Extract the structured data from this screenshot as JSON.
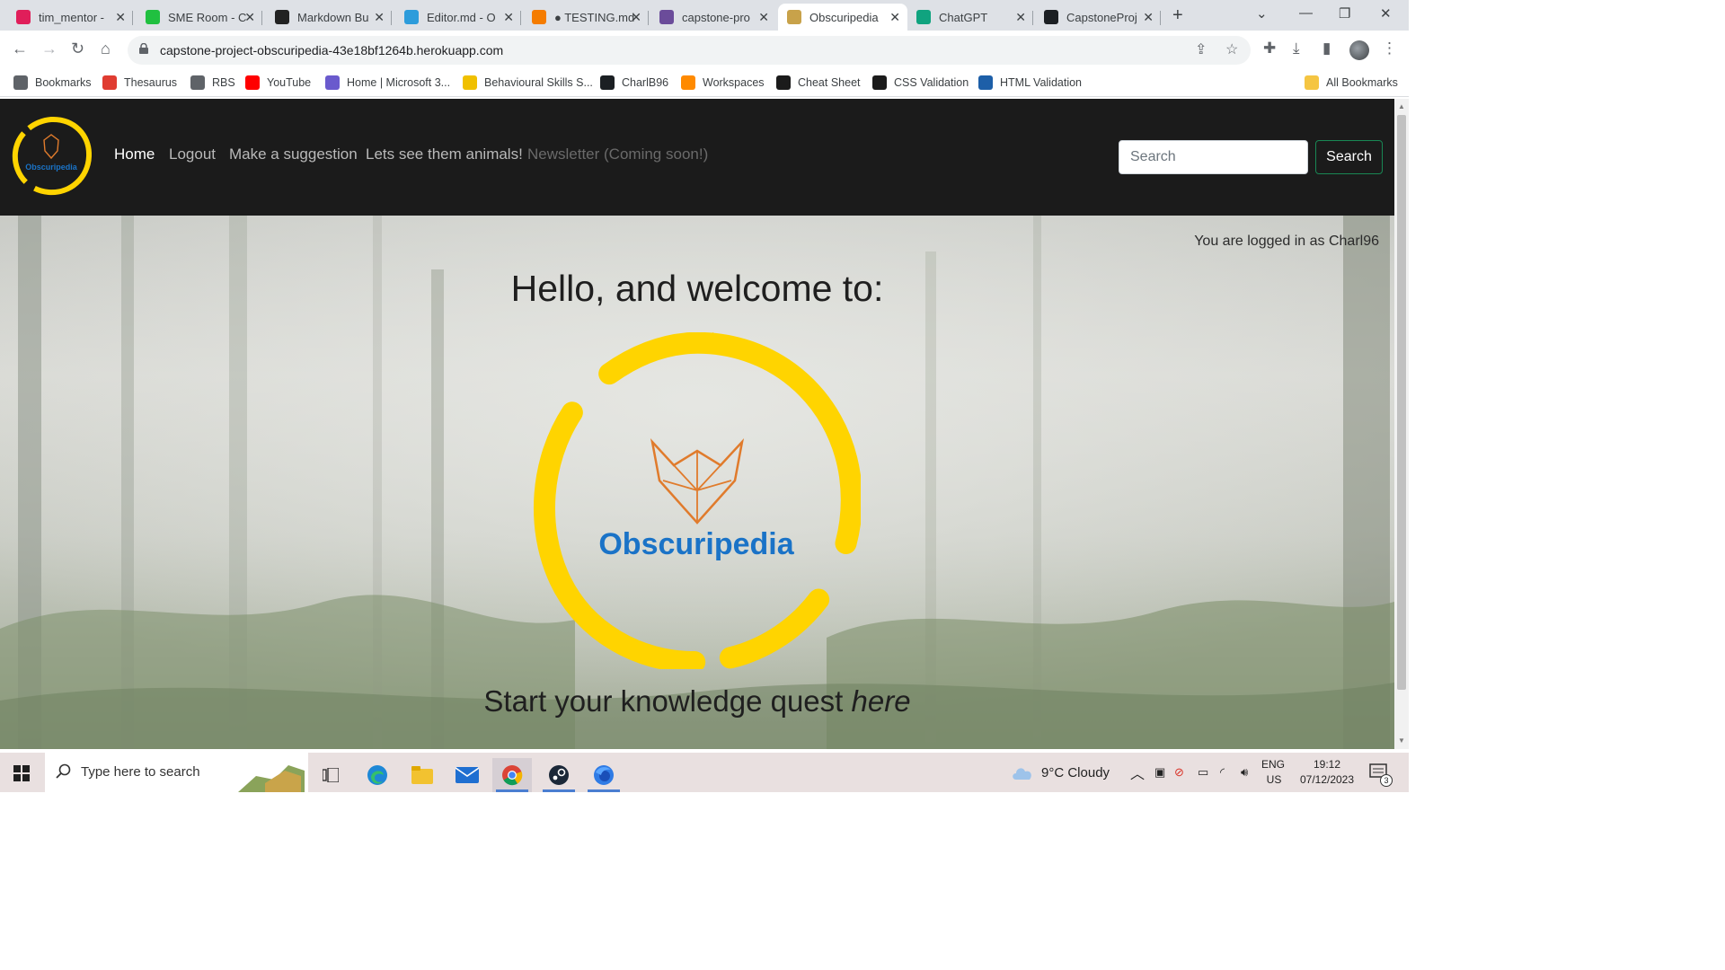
{
  "browser": {
    "tabs": [
      {
        "label": "tim_mentor -",
        "favicon_color": "#e01e5a",
        "favicon": "slack-icon"
      },
      {
        "label": "SME Room - C",
        "favicon_color": "#20c040",
        "favicon": "circle-icon"
      },
      {
        "label": "Markdown Bu",
        "favicon_color": "#222222",
        "favicon": "markdown-icon"
      },
      {
        "label": "Editor.md - O",
        "favicon_color": "#2d9cdb",
        "favicon": "m-icon"
      },
      {
        "label": "● TESTING.md",
        "favicon_color": "#f57c00",
        "favicon": "g-icon"
      },
      {
        "label": "capstone-pro",
        "favicon_color": "#6b4c9a",
        "favicon": "heroku-icon"
      },
      {
        "label": "Obscuripedia",
        "favicon_color": "#c8a24a",
        "favicon": "fox-icon"
      },
      {
        "label": "ChatGPT",
        "favicon_color": "#10a37f",
        "favicon": "chatgpt-icon"
      },
      {
        "label": "CapstoneProj",
        "favicon_color": "#1b1f23",
        "favicon": "github-icon"
      }
    ],
    "url": "capstone-project-obscuripedia-43e18bf1264b.herokuapp.com",
    "bookmarks": [
      {
        "label": "Bookmarks",
        "icon": "star-icon",
        "color": "#5f6368"
      },
      {
        "label": "Thesaurus",
        "icon": "thesaurus-icon",
        "color": "#e03c31"
      },
      {
        "label": "RBS",
        "icon": "globe-icon",
        "color": "#5f6368"
      },
      {
        "label": "YouTube",
        "icon": "youtube-icon",
        "color": "#ff0000"
      },
      {
        "label": "Home | Microsoft 3...",
        "icon": "microsoft-icon",
        "color": "#6a5acd"
      },
      {
        "label": "Behavioural Skills S...",
        "icon": "w-icon",
        "color": "#f0c000"
      },
      {
        "label": "CharlB96",
        "icon": "github-icon",
        "color": "#1b1f23"
      },
      {
        "label": "Workspaces",
        "icon": "gitpod-icon",
        "color": "#ff8a00"
      },
      {
        "label": "Cheat Sheet",
        "icon": "cheatsheet-icon",
        "color": "#1b1b1b"
      },
      {
        "label": "CSS Validation",
        "icon": "css-icon",
        "color": "#1b1b1b"
      },
      {
        "label": "HTML Validation",
        "icon": "w3-icon",
        "color": "#1d5fa8"
      }
    ],
    "all_bookmarks": "All Bookmarks"
  },
  "site": {
    "logo_text": "Obscuripedia",
    "nav": [
      {
        "label": "Home",
        "state": "active"
      },
      {
        "label": "Logout",
        "state": "normal"
      },
      {
        "label": "Make a suggestion",
        "state": "normal"
      },
      {
        "label": "Lets see them animals!",
        "state": "normal"
      },
      {
        "label": "Newsletter (Coming soon!)",
        "state": "disabled"
      }
    ],
    "search": {
      "placeholder": "Search",
      "button": "Search"
    },
    "login_status": "You are logged in as Charl96",
    "hero_title": "Hello, and welcome to:",
    "hero_logo_text": "Obscuripedia",
    "cta_prefix": "Start your knowledge quest ",
    "cta_link": "here",
    "colors": {
      "nav_bg": "#1b1b1b",
      "logo_ring": "#ffd400",
      "logo_text": "#1a73c7",
      "fox": "#e07b2c",
      "search_button_border": "#198754"
    }
  },
  "taskbar": {
    "search_placeholder": "Type here to search",
    "weather": "9°C  Cloudy",
    "lang_top": "ENG",
    "lang_bottom": "US",
    "time": "19:12",
    "date": "07/12/2023",
    "notifications": "3"
  }
}
